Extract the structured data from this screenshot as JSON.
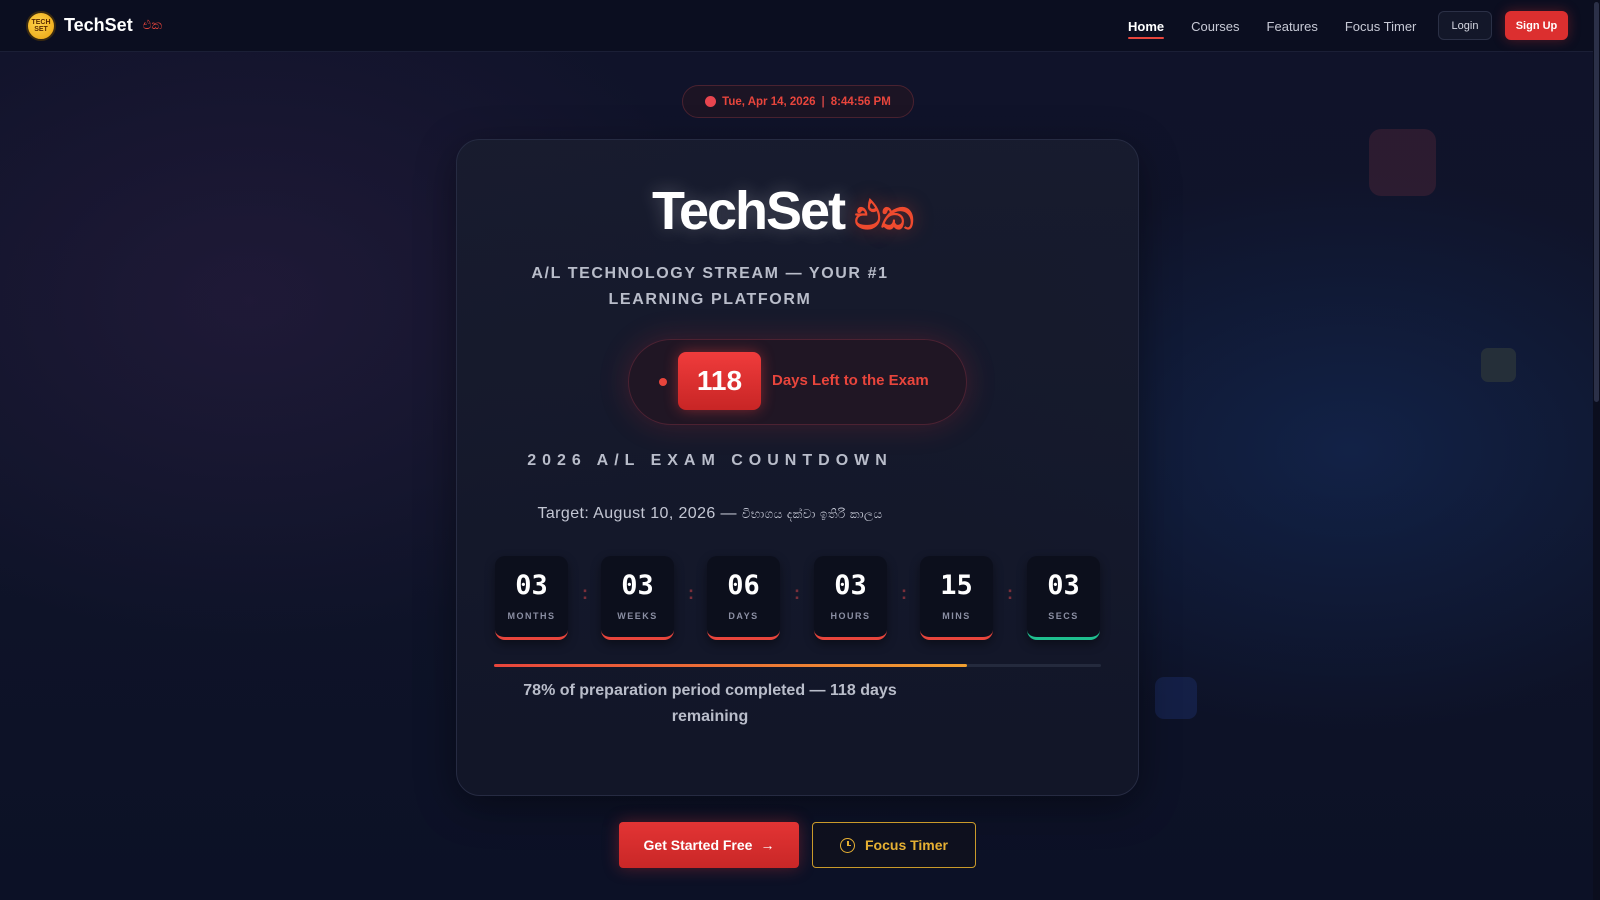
{
  "nav": {
    "brand_name": "TechSet",
    "brand_sinhala": "එක",
    "links": [
      "Home",
      "Courses",
      "Features",
      "Focus Timer"
    ],
    "login_label": "Login",
    "signup_label": "Sign Up"
  },
  "datetime": {
    "date": "Tue, Apr 14, 2026",
    "separator": "|",
    "time": "8:44:56 PM"
  },
  "hero": {
    "title": "TechSet",
    "title_sinhala": "එක",
    "subtitle": "A/L TECHNOLOGY STREAM — YOUR #1 LEARNING PLATFORM",
    "days_left": "118",
    "days_left_label": "Days Left to the Exam",
    "countdown_title": "2026 A/L EXAM COUNTDOWN",
    "target_text": "Target: August 10, 2026 —",
    "target_sinhala": "විභාගය දක්වා ඉතිරි කාලය"
  },
  "countdown": [
    {
      "value": "03",
      "label": "MONTHS"
    },
    {
      "value": "03",
      "label": "WEEKS"
    },
    {
      "value": "06",
      "label": "DAYS"
    },
    {
      "value": "03",
      "label": "HOURS"
    },
    {
      "value": "15",
      "label": "MINS"
    },
    {
      "value": "03",
      "label": "SECS"
    }
  ],
  "progress": {
    "percent": 78,
    "text": "78% of preparation period completed — 118 days remaining"
  },
  "cta": {
    "primary_label": "Get Started Free",
    "primary_arrow": "→",
    "secondary_label": "Focus Timer"
  },
  "colors": {
    "accent_red": "#e8453c",
    "accent_gold": "#e6b033",
    "accent_green": "#1fbf8f",
    "background": "#10132a"
  }
}
